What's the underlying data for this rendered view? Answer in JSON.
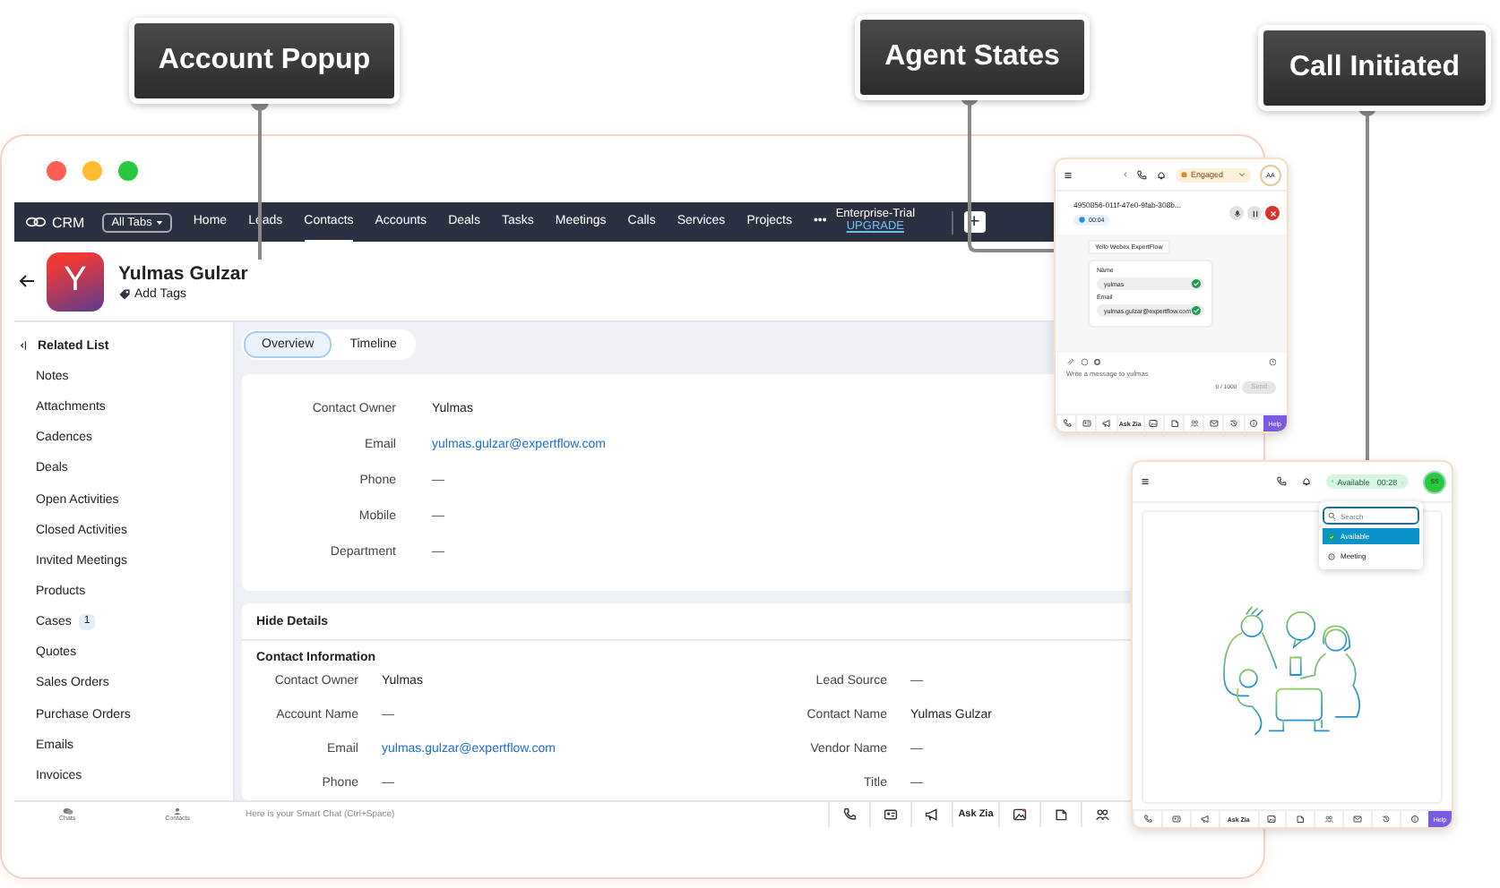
{
  "callouts": [
    {
      "label": "Account Popup"
    },
    {
      "label": "Agent States"
    },
    {
      "label": "Call Initiated"
    }
  ],
  "nav": {
    "logo": "CRM",
    "all_tabs": "All Tabs",
    "tabs": [
      {
        "label": "Home",
        "selected": false
      },
      {
        "label": "Leads",
        "selected": false
      },
      {
        "label": "Contacts",
        "selected": true
      },
      {
        "label": "Accounts",
        "selected": false
      },
      {
        "label": "Deals",
        "selected": false
      },
      {
        "label": "Tasks",
        "selected": false
      },
      {
        "label": "Meetings",
        "selected": false
      },
      {
        "label": "Calls",
        "selected": false
      },
      {
        "label": "Services",
        "selected": false
      },
      {
        "label": "Projects",
        "selected": false
      }
    ],
    "more": "•••",
    "trial": "Enterprise-Trial",
    "upgrade": "UPGRADE",
    "add": "+"
  },
  "contact": {
    "initial": "Y",
    "name": "Yulmas Gulzar",
    "add_tags": "Add Tags"
  },
  "sidebar": {
    "title": "Related List",
    "items": [
      {
        "label": "Notes"
      },
      {
        "label": "Attachments"
      },
      {
        "label": "Cadences"
      },
      {
        "label": "Deals"
      },
      {
        "label": "Open Activities"
      },
      {
        "label": "Closed Activities"
      },
      {
        "label": "Invited Meetings"
      },
      {
        "label": "Products"
      },
      {
        "label": "Cases",
        "count": "1"
      },
      {
        "label": "Quotes"
      },
      {
        "label": "Sales Orders"
      },
      {
        "label": "Purchase Orders"
      },
      {
        "label": "Emails"
      },
      {
        "label": "Invoices"
      }
    ]
  },
  "view_tabs": [
    {
      "label": "Overview",
      "selected": true
    },
    {
      "label": "Timeline",
      "selected": false
    }
  ],
  "summary": [
    {
      "label": "Contact Owner",
      "value": "Yulmas",
      "kind": "text"
    },
    {
      "label": "Email",
      "value": "yulmas.gulzar@expertflow.com",
      "kind": "link"
    },
    {
      "label": "Phone",
      "value": "—",
      "kind": "empty"
    },
    {
      "label": "Mobile",
      "value": "—",
      "kind": "empty"
    },
    {
      "label": "Department",
      "value": "—",
      "kind": "empty"
    }
  ],
  "details": {
    "toggle": "Hide Details",
    "section": "Contact Information",
    "left": [
      {
        "label": "Contact Owner",
        "value": "Yulmas",
        "kind": "text"
      },
      {
        "label": "Account Name",
        "value": "—",
        "kind": "empty"
      },
      {
        "label": "Email",
        "value": "yulmas.gulzar@expertflow.com",
        "kind": "link"
      },
      {
        "label": "Phone",
        "value": "—",
        "kind": "empty"
      }
    ],
    "right": [
      {
        "label": "Lead Source",
        "value": "—",
        "kind": "empty"
      },
      {
        "label": "Contact Name",
        "value": "Yulmas Gulzar",
        "kind": "text"
      },
      {
        "label": "Vendor Name",
        "value": "—",
        "kind": "empty"
      },
      {
        "label": "Title",
        "value": "—",
        "kind": "empty"
      }
    ]
  },
  "bottom_bar": {
    "apps": [
      {
        "label": "Chats"
      },
      {
        "label": "Contacts"
      }
    ],
    "placeholder": "Here is your Smart Chat (Ctrl+Space)",
    "ask": "Ask Zia"
  },
  "agent_popup": {
    "back": "‹",
    "status": "Engaged",
    "avatar": "AA",
    "call_id": "4950856-011f-47e0-9fab-308b...",
    "timer": "00:04",
    "source": "Yello Webex ExpertFlow",
    "form": [
      {
        "label": "Name",
        "value": "yulmas"
      },
      {
        "label": "Email",
        "value": "yulmas.gulzar@expertflow.com"
      }
    ],
    "placeholder": "Write a message to yulmas",
    "counter": "0 / 1000",
    "send": {
      "label": "Send",
      "disabled": true
    },
    "ask": "Ask Zia",
    "help": "Help"
  },
  "call_popup": {
    "status": "Available",
    "timer": "00:28",
    "avatar": "SS",
    "search_placeholder": "Search",
    "options": [
      {
        "label": "Available",
        "selected": true
      },
      {
        "label": "Meeting",
        "selected": false
      }
    ],
    "ask": "Ask Zia",
    "help": "Help"
  }
}
